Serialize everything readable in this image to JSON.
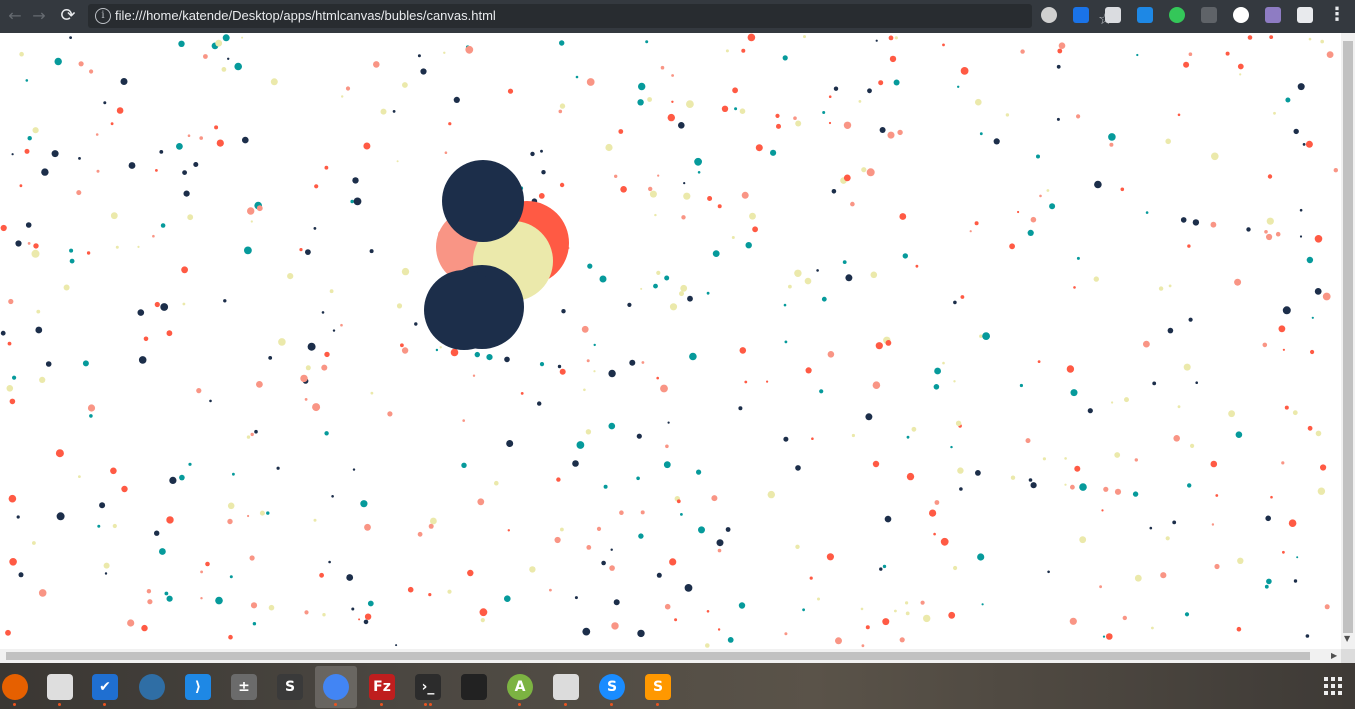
{
  "browser": {
    "url": "file:///home/katende/Desktop/apps/htmlcanvas/bubles/canvas.html",
    "back_glyph": "←",
    "forward_glyph": "→",
    "reload_glyph": "⟳",
    "info_glyph": "i",
    "star_glyph": "☆",
    "menu_glyph": "⋮",
    "extensions": [
      {
        "name": "extension-circle-icon",
        "color": "#d0d0d0"
      },
      {
        "name": "download-extension-icon",
        "color": "#1a73e8"
      },
      {
        "name": "save-extension-icon",
        "color": "#dadce0"
      },
      {
        "name": "s-extension-icon",
        "color": "#1e88e5"
      },
      {
        "name": "green-extension-icon",
        "color": "#34c759"
      },
      {
        "name": "gray-extension-icon",
        "color": "#5f6368"
      },
      {
        "name": "panda-extension-icon",
        "color": "#ffffff"
      },
      {
        "name": "pen-extension-icon",
        "color": "#8e7cc3"
      },
      {
        "name": "react-extension-icon",
        "color": "#e8eaed"
      }
    ]
  },
  "canvas": {
    "palette": [
      "#1c2e4a",
      "#ff5a44",
      "#f99585",
      "#ebe9ab",
      "#069a9b"
    ],
    "dot_count": 620,
    "seed": 7,
    "large_bubbles": [
      {
        "color": "#ff5a44"
      },
      {
        "color": "#f99585"
      },
      {
        "color": "#ebe9ab"
      },
      {
        "color": "#1c2e4a"
      },
      {
        "color": "#1c2e4a"
      },
      {
        "color": "#1c2e4a"
      }
    ]
  },
  "taskbar": {
    "apps": [
      {
        "name": "firefox-icon",
        "label": "",
        "color": "#e66000"
      },
      {
        "name": "files-icon",
        "label": "",
        "color": "#dedede"
      },
      {
        "name": "tasks-icon",
        "label": "✔",
        "color": "#1f6fd1"
      },
      {
        "name": "shark-app-icon",
        "label": "",
        "color": "#2f6ea5"
      },
      {
        "name": "vscode-icon",
        "label": "⟩",
        "color": "#1e88e5"
      },
      {
        "name": "calculator-icon",
        "label": "±",
        "color": "#6b6b6b"
      },
      {
        "name": "sublime-s-icon",
        "label": "S",
        "color": "#3a3a3a"
      },
      {
        "name": "chrome-icon",
        "label": "",
        "color": "#4285f4"
      },
      {
        "name": "filezilla-icon",
        "label": "Fz",
        "color": "#bf1e1e"
      },
      {
        "name": "terminal-icon",
        "label": "›_",
        "color": "#2c2c2c"
      },
      {
        "name": "video-editor-icon",
        "label": "",
        "color": "#222222"
      },
      {
        "name": "android-studio-icon",
        "label": "A",
        "color": "#7cb342"
      },
      {
        "name": "window-app-icon",
        "label": "",
        "color": "#dcdcdc"
      },
      {
        "name": "skype-icon",
        "label": "S",
        "color": "#1a8cff"
      },
      {
        "name": "sublime-text-icon",
        "label": "S",
        "color": "#ff9800"
      }
    ]
  }
}
